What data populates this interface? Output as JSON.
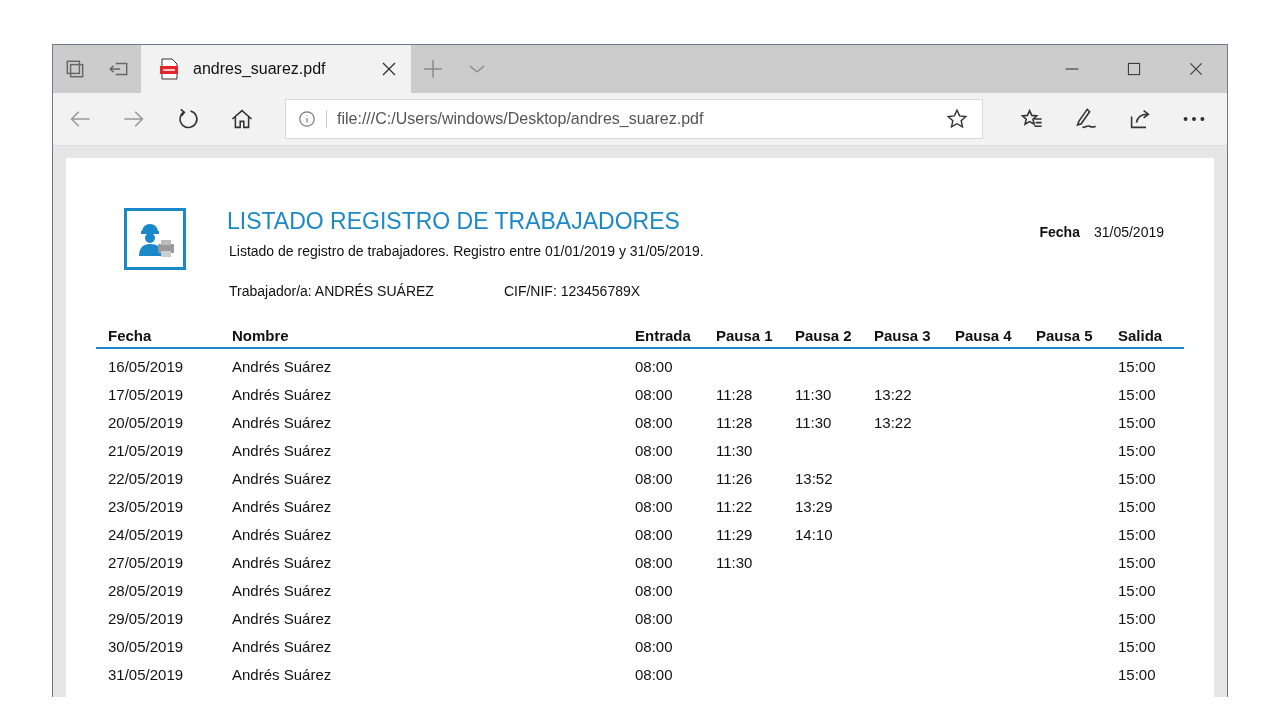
{
  "tab": {
    "title": "andres_suarez.pdf",
    "selected": true
  },
  "address_bar": {
    "value": "file:///C:/Users/windows/Desktop/andres_suarez.pdf"
  },
  "document": {
    "title": "LISTADO REGISTRO DE TRABAJADORES",
    "subtitle": "Listado de registro de trabajadores. Registro entre 01/01/2019 y 31/05/2019.",
    "date_label": "Fecha",
    "date_value": "31/05/2019",
    "worker": "Trabajador/a: ANDRÉS SUÁREZ",
    "tax_id": "CIF/NIF: 123456789X",
    "columns": [
      "Fecha",
      "Nombre",
      "Entrada",
      "Pausa 1",
      "Pausa 2",
      "Pausa 3",
      "Pausa 4",
      "Pausa 5",
      "Salida"
    ],
    "rows": [
      {
        "date": "16/05/2019",
        "name": "Andrés Suárez",
        "in": "08:00",
        "breaks": [],
        "out": "15:00"
      },
      {
        "date": "17/05/2019",
        "name": "Andrés Suárez",
        "in": "08:00",
        "breaks": [
          "11:28",
          "11:30",
          "13:22"
        ],
        "out": "15:00"
      },
      {
        "date": "20/05/2019",
        "name": "Andrés Suárez",
        "in": "08:00",
        "breaks": [
          "11:28",
          "11:30",
          "13:22"
        ],
        "out": "15:00"
      },
      {
        "date": "21/05/2019",
        "name": "Andrés Suárez",
        "in": "08:00",
        "breaks": [
          "11:30"
        ],
        "out": "15:00"
      },
      {
        "date": "22/05/2019",
        "name": "Andrés Suárez",
        "in": "08:00",
        "breaks": [
          "11:26",
          "13:52"
        ],
        "out": "15:00"
      },
      {
        "date": "23/05/2019",
        "name": "Andrés Suárez",
        "in": "08:00",
        "breaks": [
          "11:22",
          "13:29"
        ],
        "out": "15:00"
      },
      {
        "date": "24/05/2019",
        "name": "Andrés Suárez",
        "in": "08:00",
        "breaks": [
          "11:29",
          "14:10"
        ],
        "out": "15:00"
      },
      {
        "date": "27/05/2019",
        "name": "Andrés Suárez",
        "in": "08:00",
        "breaks": [
          "11:30"
        ],
        "out": "15:00"
      },
      {
        "date": "28/05/2019",
        "name": "Andrés Suárez",
        "in": "08:00",
        "breaks": [],
        "out": "15:00"
      },
      {
        "date": "29/05/2019",
        "name": "Andrés Suárez",
        "in": "08:00",
        "breaks": [],
        "out": "15:00"
      },
      {
        "date": "30/05/2019",
        "name": "Andrés Suárez",
        "in": "08:00",
        "breaks": [],
        "out": "15:00"
      },
      {
        "date": "31/05/2019",
        "name": "Andrés Suárez",
        "in": "08:00",
        "breaks": [],
        "out": "15:00"
      }
    ]
  }
}
